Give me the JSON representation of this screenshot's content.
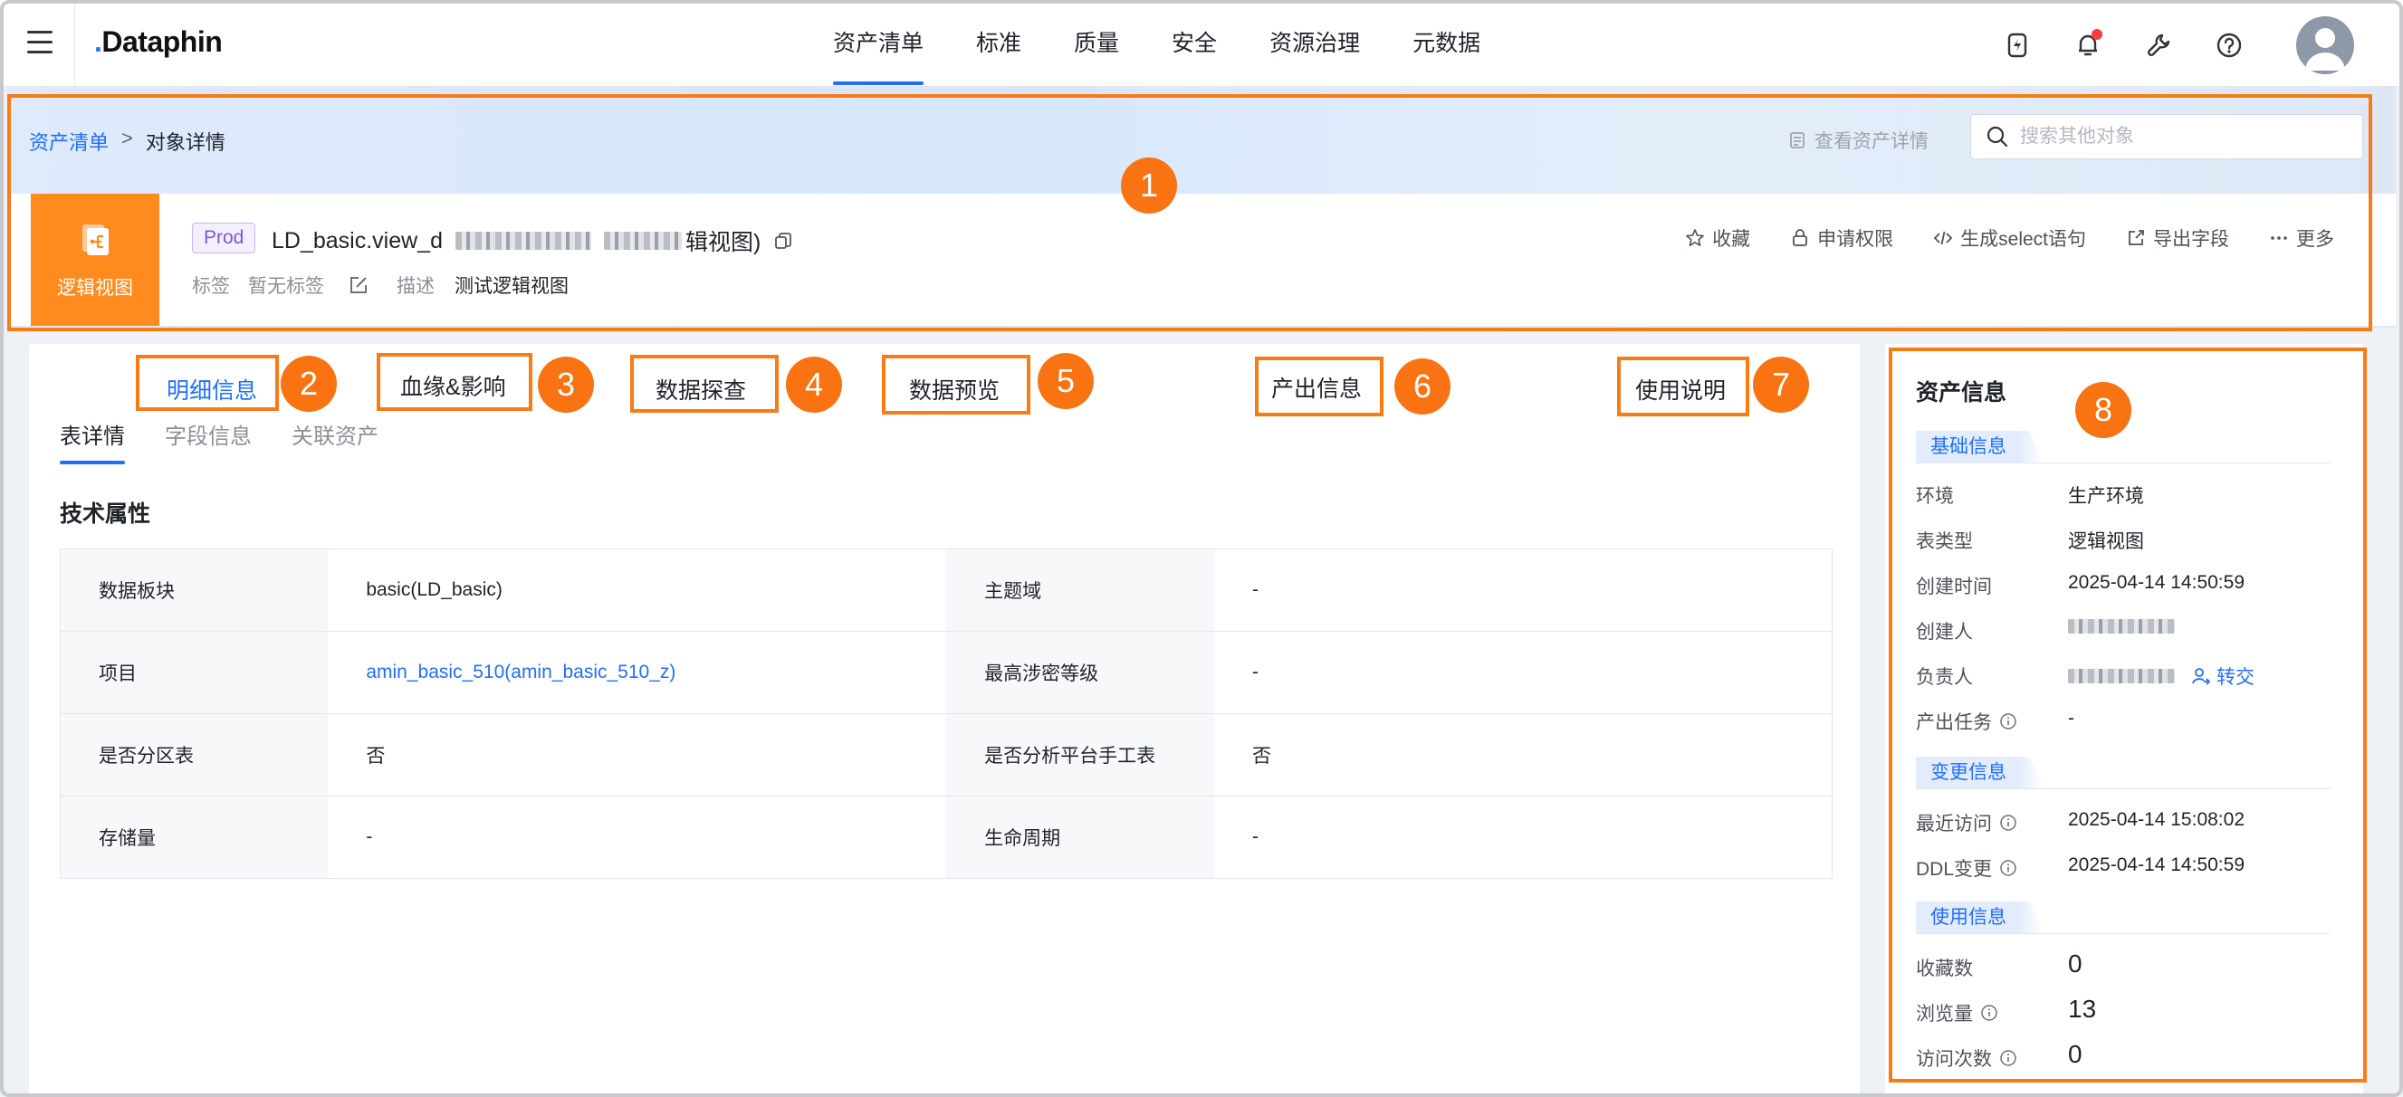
{
  "topnav": {
    "logo": "Dataphin",
    "tabs": [
      "资产清单",
      "标准",
      "质量",
      "安全",
      "资源治理",
      "元数据"
    ],
    "active_tab": 0
  },
  "header": {
    "breadcrumb": {
      "root": "资产清单",
      "sep": ">",
      "current": "对象详情"
    },
    "asset_detail_link": "查看资产详情",
    "search_placeholder": "搜索其他对象",
    "object_type": "逻辑视图",
    "env_badge": "Prod",
    "name_prefix": "LD_basic.view_d",
    "name_suffix": "辑视图)",
    "tags_label": "标签",
    "tags_value": "暂无标签",
    "desc_label": "描述",
    "desc_value": "测试逻辑视图",
    "actions": [
      "收藏",
      "申请权限",
      "生成select语句",
      "导出字段",
      "更多"
    ]
  },
  "features": [
    "明细信息",
    "血缘&影响",
    "数据探查",
    "数据预览",
    "产出信息",
    "使用说明"
  ],
  "subtabs": [
    "表详情",
    "字段信息",
    "关联资产"
  ],
  "section_title": "技术属性",
  "props": [
    {
      "k1": "数据板块",
      "v1": "basic(LD_basic)",
      "k2": "主题域",
      "v2": "-"
    },
    {
      "k1": "项目",
      "v1": "amin_basic_510(amin_basic_510_z)",
      "k2": "最高涉密等级",
      "v2": "-"
    },
    {
      "k1": "是否分区表",
      "v1": "否",
      "k2": "是否分析平台手工表",
      "v2": "否"
    },
    {
      "k1": "存储量",
      "v1": "-",
      "k2": "生命周期",
      "v2": "-"
    }
  ],
  "side": {
    "title": "资产信息",
    "basic_section": "基础信息",
    "env_label": "环境",
    "env_value": "生产环境",
    "type_label": "表类型",
    "type_value": "逻辑视图",
    "created_label": "创建时间",
    "created_value": "2025-04-14 14:50:59",
    "creator_label": "创建人",
    "owner_label": "负责人",
    "transfer_label": "转交",
    "task_label": "产出任务",
    "task_value": "-",
    "change_section": "变更信息",
    "visit_label": "最近访问",
    "visit_value": "2025-04-14 15:08:02",
    "ddl_label": "DDL变更",
    "ddl_value": "2025-04-14 14:50:59",
    "usage_section": "使用信息",
    "fav_label": "收藏数",
    "fav_value": "0",
    "views_label": "浏览量",
    "views_value": "13",
    "visits_label": "访问次数",
    "visits_value": "0"
  },
  "annotations": [
    "1",
    "2",
    "3",
    "4",
    "5",
    "6",
    "7",
    "8"
  ],
  "colors": {
    "accent": "#1f6fff",
    "annotation": "#fa7a14",
    "object_icon": "#ff8a1e"
  }
}
